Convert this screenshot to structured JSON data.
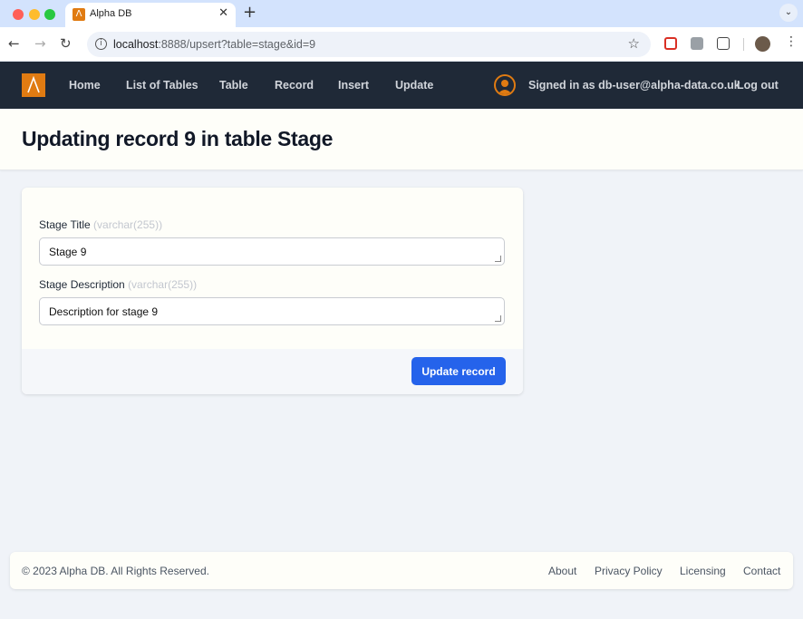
{
  "browser": {
    "tab_title": "Alpha DB",
    "tab_close": "✕",
    "new_tab": "+",
    "url_host": "localhost",
    "url_rest": ":8888/upsert?table=stage&id=9"
  },
  "nav": {
    "items": [
      "Home",
      "List of Tables",
      "Table",
      "Record",
      "Insert",
      "Update"
    ],
    "signed_in": "Signed in as db-user@alpha-data.co.uk",
    "logout": "Log out"
  },
  "header": {
    "title": "Updating record 9 in table Stage"
  },
  "form": {
    "fields": [
      {
        "label": "Stage Title",
        "type": "(varchar(255))",
        "value": "Stage 9"
      },
      {
        "label": "Stage Description",
        "type": "(varchar(255))",
        "value": "Description for stage 9"
      }
    ],
    "submit_label": "Update record"
  },
  "footer": {
    "copyright": "© 2023 Alpha DB. All Rights Reserved.",
    "links": [
      "About",
      "Privacy Policy",
      "Licensing",
      "Contact"
    ]
  },
  "colors": {
    "nav_bg": "#1f2937",
    "brand_orange": "#e07b12",
    "primary_button": "#2563eb"
  }
}
